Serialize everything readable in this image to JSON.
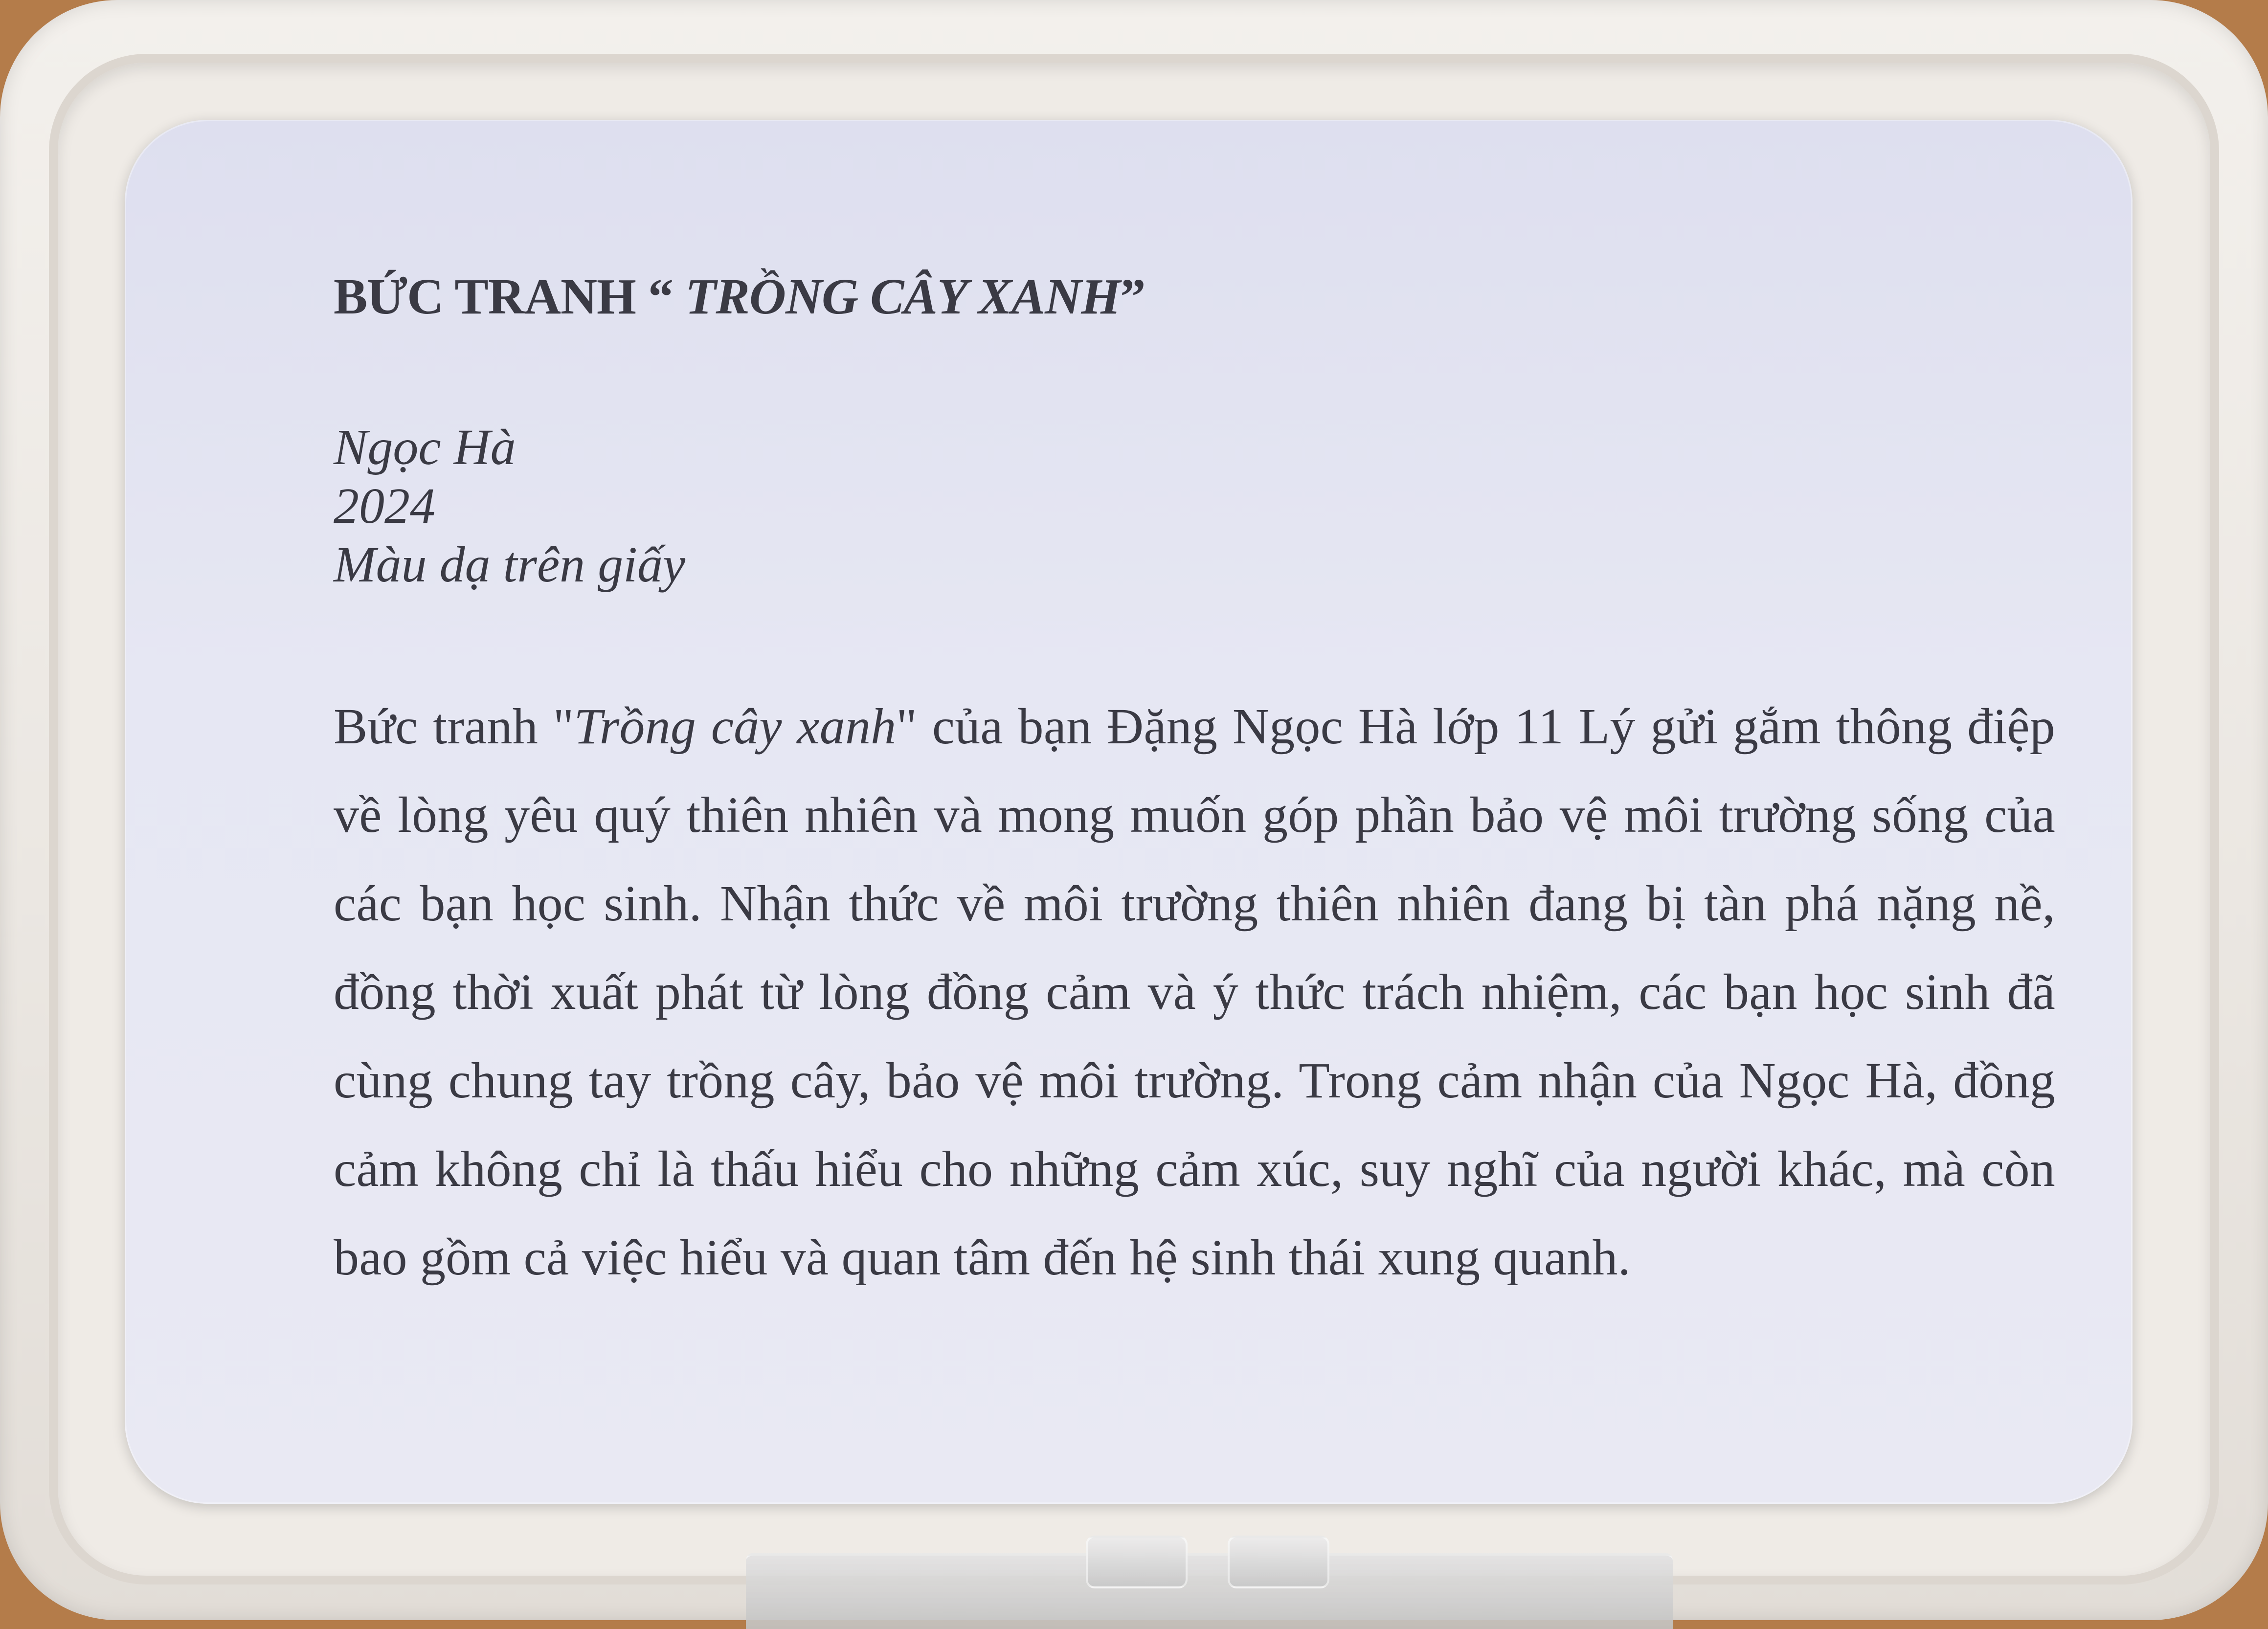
{
  "placard": {
    "title_prefix": "BỨC TRANH “ ",
    "title_italic": "TRỒNG CÂY XANH",
    "title_suffix": "”",
    "artist": "Ngọc Hà",
    "year": "2024",
    "medium": "Màu dạ trên giấy",
    "description": {
      "part1": "Bức tranh \"",
      "italic": "Trồng cây xanh",
      "part2": "\" của bạn Đặng Ngọc Hà lớp 11 Lý gửi gắm thông điệp về lòng yêu quý thiên nhiên và mong muốn góp phần bảo vệ môi trường sống của các bạn học sinh. Nhận thức về môi trường thiên nhiên đang bị tàn phá nặng nề, đồng thời xuất phát từ lòng đồng cảm và ý thức trách nhiệm, các bạn học sinh đã cùng chung tay trồng cây, bảo vệ môi trường. Trong cảm nhận của Ngọc Hà, đồng cảm không chỉ là thấu hiểu cho những cảm xúc, suy nghĩ của người khác, mà còn bao gồm cả việc hiểu và quan tâm đến hệ sinh thái xung quanh."
    }
  }
}
